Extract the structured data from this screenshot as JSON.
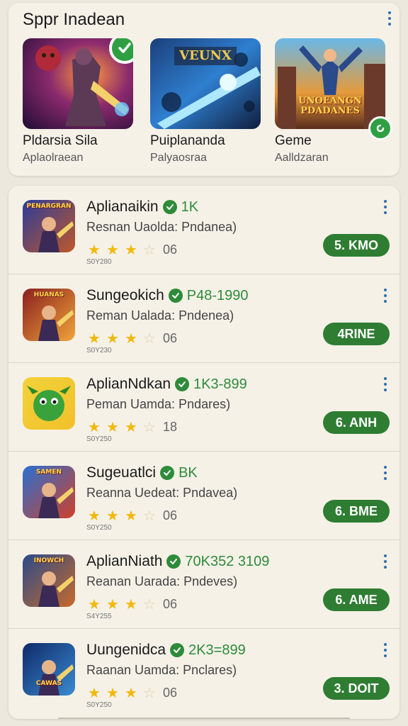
{
  "featured": {
    "title": "Sppr Inadean",
    "items": [
      {
        "name": "Pldarsia Sila",
        "subtitle": "Aplaolraean",
        "badge": "check-icon"
      },
      {
        "name": "Puiplananda",
        "subtitle": "Palyaosraa",
        "art_text": "VEUNX"
      },
      {
        "name": "Geme",
        "subtitle": "Aalldzaran",
        "art_text": "UNOEANGN PDADANES",
        "badge": "refresh-icon"
      }
    ]
  },
  "apps": [
    {
      "title": "Aplianaikin",
      "stat": "1K",
      "subtitle": "Resnan Uaolda: Pndanea)",
      "stars": 3,
      "rating": "06",
      "tiny": "S0Y280",
      "button": "5. KMO",
      "icon_text": "PENARGRAN"
    },
    {
      "title": "Sungeokich",
      "stat": "P48-1990",
      "subtitle": "Reman Ualada: Pndenea)",
      "stars": 3,
      "rating": "06",
      "tiny": "S0Y230",
      "button": "4RINE",
      "icon_text": "HUANAS"
    },
    {
      "title": "AplianNdkan",
      "stat": "1K3-899",
      "subtitle": "Peman Uamda: Pndares)",
      "stars": 3,
      "rating": "18",
      "tiny": "S0Y250",
      "button": "6. ANH",
      "icon_text": ""
    },
    {
      "title": "Sugeuatlci",
      "stat": "BK",
      "subtitle": "Reanna Uedeat: Pndavea)",
      "stars": 3,
      "rating": "06",
      "tiny": "S0Y250",
      "button": "6. BME",
      "icon_text": "SAMEN"
    },
    {
      "title": "AplianNiath",
      "stat": "70K352 3109",
      "subtitle": "Reanan Uarada: Pndeves)",
      "stars": 3,
      "rating": "06",
      "tiny": "S4Y255",
      "button": "6. AME",
      "icon_text": "INOWCH"
    },
    {
      "title": "Uungenidca",
      "stat": "2K3=899",
      "subtitle": "Raanan Uamda: Pnclares)",
      "stars": 3,
      "rating": "06",
      "tiny": "S0Y250",
      "button": "3. DOIT",
      "icon_text": "CAWAS"
    }
  ],
  "colors": {
    "accent_green": "#2e7d32",
    "verified_green": "#2e8b3a",
    "star_gold": "#f2b90d",
    "menu_blue": "#2f6fb0",
    "background": "#ece8dd"
  }
}
